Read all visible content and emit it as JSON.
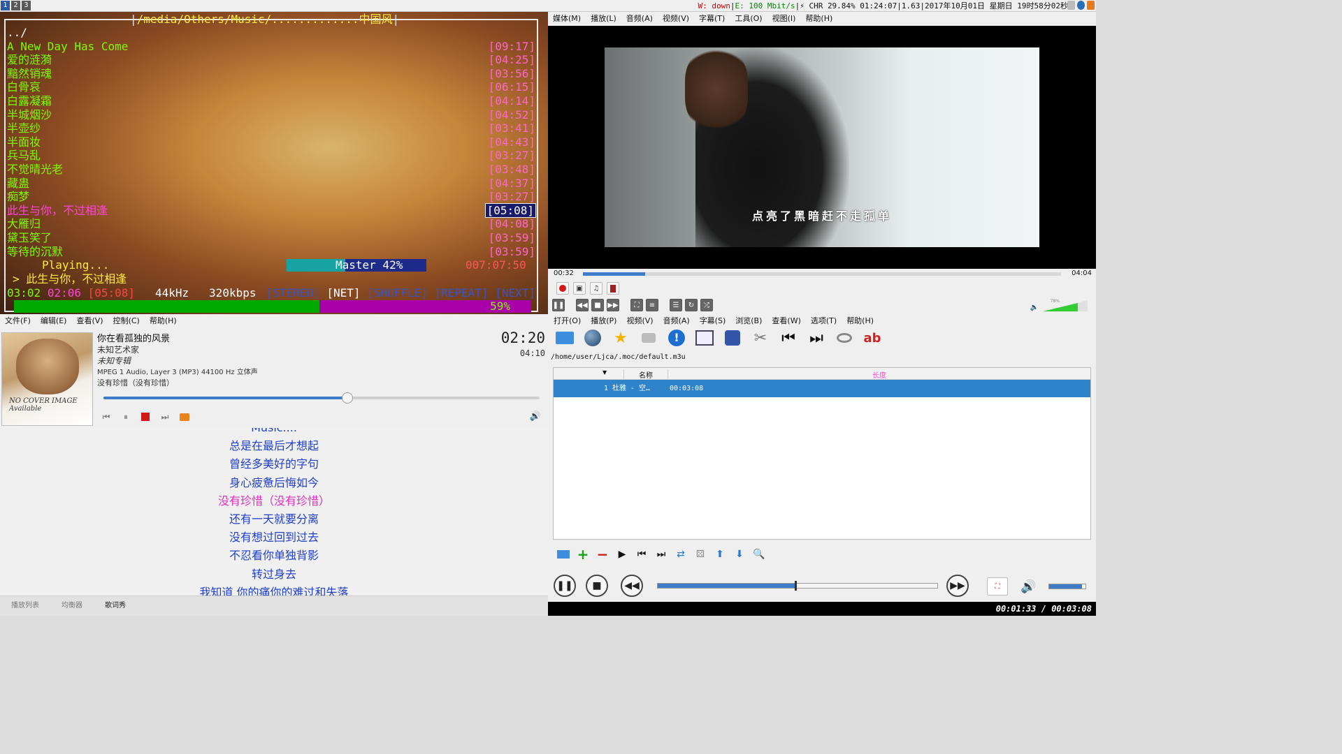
{
  "topbar": {
    "workspaces": [
      "1",
      "2",
      "3"
    ],
    "status_wifi": "W: down",
    "status_eth": "E: 100 Mbit/s",
    "status_bat": "⚡ CHR 29.84% 01:24:07",
    "status_load": "1.63",
    "status_date": "2017年10月01日 星期日 19时58分02秒"
  },
  "moc": {
    "path": "/media/Others/Music/.............中国风",
    "parent": "../",
    "tracks": [
      {
        "title": "A New Day Has Come",
        "time": "[09:17]"
      },
      {
        "title": "爱的涟漪",
        "time": "[04:25]"
      },
      {
        "title": "黯然销魂",
        "time": "[03:56]"
      },
      {
        "title": "白骨哀",
        "time": "[06:15]"
      },
      {
        "title": "白露凝霜",
        "time": "[04:14]"
      },
      {
        "title": "半城烟沙",
        "time": "[04:52]"
      },
      {
        "title": "半壶纱",
        "time": "[03:41]"
      },
      {
        "title": "半面妆",
        "time": "[04:43]"
      },
      {
        "title": "兵马乱",
        "time": "[03:27]"
      },
      {
        "title": "不觉晴光老",
        "time": "[03:48]"
      },
      {
        "title": "藏蛊",
        "time": "[04:37]"
      },
      {
        "title": "痴梦",
        "time": "[03:27]"
      },
      {
        "title": "此生与你，不过相逢",
        "time": "[05:08]"
      },
      {
        "title": "大雁归",
        "time": "[04:08]"
      },
      {
        "title": "黛玉笑了",
        "time": "[03:59]"
      },
      {
        "title": "等待的沉默",
        "time": "[03:59]"
      }
    ],
    "playing_label": "Playing...",
    "mixer_label": "Master  42%",
    "mixer_level": 0.42,
    "total_time": "007:07:50",
    "now_title": "> 此生与你，不过相逢",
    "elapsed": "03:02",
    "remaining": "02:06",
    "duration": "[05:08]",
    "rate": "44kHz",
    "bitrate": "320kbps",
    "flag_stereo": "[STEREO]",
    "flag_net": "[NET]",
    "flag_shuffle": "[SHUFFLE]",
    "flag_repeat": "[REPEAT]",
    "flag_next": "[NEXT]",
    "progress_label": "59%",
    "progress": 0.59
  },
  "audacious": {
    "menu": [
      "文件(F)",
      "编辑(E)",
      "查看(V)",
      "控制(C)",
      "帮助(H)"
    ],
    "cover_text1": "NO COVER IMAGE",
    "cover_text2": "Available",
    "title": "你在看孤独的风景",
    "artist": "未知艺术家",
    "album": "未知专辑",
    "format": "MPEG 1 Audio, Layer 3 (MP3) 44100 Hz 立体声",
    "subtitle": "没有珍惜（没有珍惜）",
    "time": "02:20",
    "length": "04:10",
    "seek_fraction": 0.56,
    "lyrics": [
      "Music....",
      "总是在最后才想起",
      "曾经多美好的字句",
      "身心疲惫后悔如今",
      "没有珍惜（没有珍惜）",
      "还有一天就要分离",
      "没有想过回到过去",
      "不忍看你单独背影",
      "转过身去",
      "我知道 你的痛你的难过和失落"
    ],
    "lyrics_highlight_index": 4,
    "tabs": [
      "播放列表",
      "均衡器",
      "歌词秀"
    ]
  },
  "smplayer": {
    "menu": [
      "媒体(M)",
      "播放(L)",
      "音频(A)",
      "视频(V)",
      "字幕(T)",
      "工具(O)",
      "视图(I)",
      "帮助(H)"
    ],
    "subtitle": "点亮了黑暗赶不走孤单",
    "time_current": "00:32",
    "time_total": "04:04",
    "seek_fraction": 0.13,
    "volume_label": "78%",
    "volume_level": 0.78
  },
  "vlc": {
    "menu": [
      "打开(O)",
      "播放(P)",
      "视频(V)",
      "音频(A)",
      "字幕(S)",
      "浏览(B)",
      "查看(W)",
      "选项(T)",
      "帮助(H)"
    ],
    "playlist_path": "/home/user/Ljca/.moc/default.m3u",
    "col_name": "名称",
    "col_length": "长度",
    "row_index": "1",
    "row_name": "杜雅 - 空…",
    "row_length": "00:03:08",
    "seek_fraction": 0.49,
    "volume_fraction": 0.9,
    "status_time": "00:01:33 / 00:03:08"
  },
  "colors": {
    "accent": "#3d7cc9",
    "moc_green": "#7CFC00",
    "moc_pink": "#ff44dd",
    "moc_yellow": "#ffeb3b"
  }
}
